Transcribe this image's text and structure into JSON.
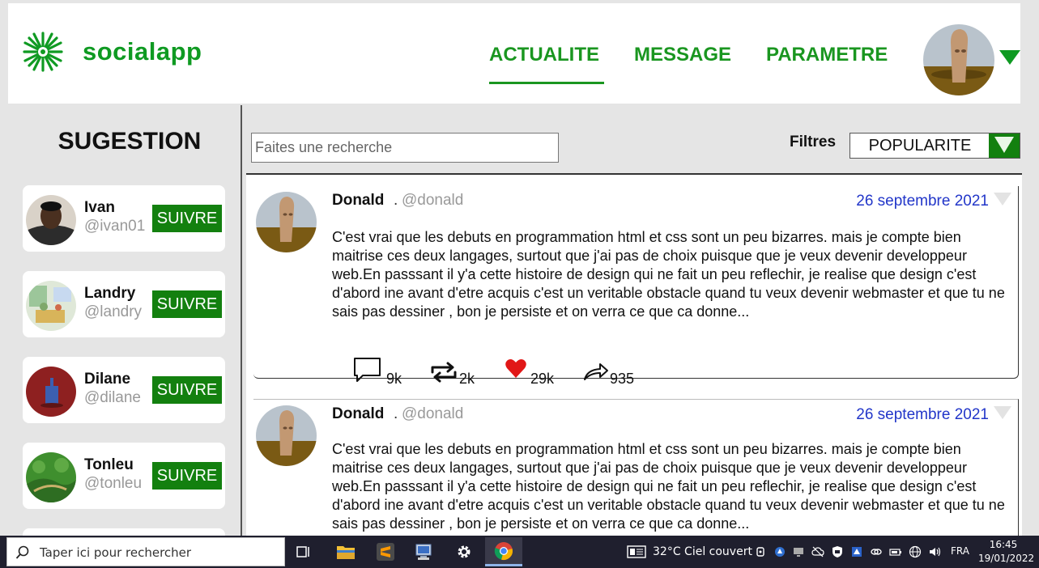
{
  "app": {
    "name": "socialapp",
    "brand_color": "#0f9a22",
    "accent_button": "#13800f"
  },
  "nav": {
    "items": [
      {
        "label": "ACTUALITE",
        "active": true
      },
      {
        "label": "MESSAGE",
        "active": false
      },
      {
        "label": "PARAMETRE",
        "active": false
      }
    ]
  },
  "sidebar": {
    "title": "SUGESTION",
    "follow_label": "SUIVRE",
    "suggestions": [
      {
        "name": "Ivan",
        "handle": "@ivan01"
      },
      {
        "name": "Landry",
        "handle": "@landry"
      },
      {
        "name": "Dilane",
        "handle": "@dilane"
      },
      {
        "name": "Tonleu",
        "handle": "@tonleu"
      }
    ]
  },
  "toolbar": {
    "search_placeholder": "Faites une recherche",
    "filters_label": "Filtres",
    "filter_value": "POPULARITE"
  },
  "feed": {
    "posts": [
      {
        "author": "Donald",
        "separator": ".",
        "handle": "@donald",
        "date": "26 septembre 2021",
        "text": "C'est vrai que les debuts en programmation html et css sont un peu bizarres. mais je compte bien maitrise ces deux langages, surtout que j'ai pas de choix puisque que je veux devenir developpeur web.En passsant il y'a cette histoire de design qui ne fait un peu reflechir, je realise que design c'est d'abord ine avant d'etre acquis c'est un veritable obstacle quand tu veux devenir webmaster et que tu ne sais pas dessiner , bon je persiste et on verra ce que ca donne...",
        "comments": "9k",
        "reposts": "2k",
        "likes": "29k",
        "shares": "935"
      },
      {
        "author": "Donald",
        "separator": ".",
        "handle": "@donald",
        "date": "26 septembre 2021",
        "text": "C'est vrai que les debuts en programmation html et css sont un peu bizarres. mais je compte bien maitrise ces deux langages, surtout que j'ai pas de choix puisque que je veux devenir developpeur web.En passsant il y'a cette histoire de design qui ne fait un peu reflechir, je realise que design c'est d'abord ine avant d'etre acquis c'est un veritable obstacle quand tu veux devenir webmaster et que tu ne sais pas dessiner , bon je persiste et on verra ce que ca donne..."
      }
    ]
  },
  "taskbar": {
    "search_placeholder": "Taper ici pour rechercher",
    "weather": "32°C  Ciel couvert",
    "language": "FRA",
    "time": "16:45",
    "date": "19/01/2022"
  }
}
